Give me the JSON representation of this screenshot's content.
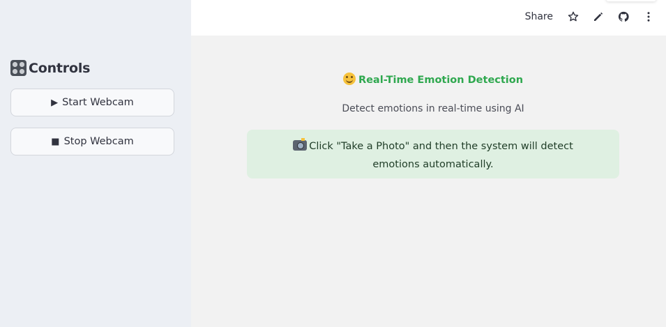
{
  "sidebar": {
    "title": "Controls",
    "title_icon": "control-knobs-icon",
    "buttons": [
      {
        "glyph": "▶",
        "label": "Start Webcam"
      },
      {
        "glyph": "■",
        "label": "Stop Webcam"
      }
    ]
  },
  "toolbar": {
    "share_label": "Share",
    "icons": [
      "star-icon",
      "edit-pencil-icon",
      "github-icon",
      "more-vertical-icon"
    ]
  },
  "main": {
    "title": "Real-Time Emotion Detection",
    "title_icon": "smiley-icon",
    "subtitle": "Detect emotions in real-time using AI",
    "info_text": "Click \"Take a Photo\" and then the system will detect emotions automatically.",
    "info_icon": "camera-flash-icon"
  },
  "colors": {
    "accent_green": "#2fa84f",
    "info_bg": "#dff0e2",
    "sidebar_bg": "#eceff4",
    "main_bg": "#f2f2f2"
  }
}
